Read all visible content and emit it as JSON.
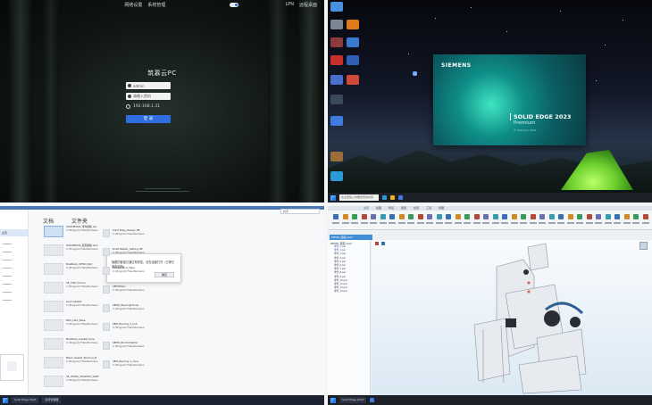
{
  "q1": {
    "top_links": [
      "网络设置",
      "系统管理"
    ],
    "right_labels": [
      "LPN",
      "远程桌面"
    ],
    "title": "筑慕云PC",
    "username": "admin",
    "password_placeholder": "请输入密码",
    "ip": "192.168.1.31",
    "login_label": "登 录"
  },
  "q2": {
    "splash_brand": "SIEMENS",
    "splash_title": "SOLID EDGE 2023",
    "splash_edition": "Premium",
    "splash_version": "© Siemens 2022",
    "taskbar_search": "在这里输入你要搜索的内容",
    "colors": {
      "splash_accent": "#3fe6c2",
      "tent": "#6ccf2c",
      "taskbar": "#1d2026"
    }
  },
  "q3": {
    "header_left": "文档",
    "header_right": "文件夹",
    "search_placeholder": "搜索",
    "sidebar_selected": "主页",
    "files_left": [
      {
        "name": "SOLIDEDGE_零件模板.par",
        "path": "C:/Program Files/Siemens"
      },
      {
        "name": "SOLIDEDGE_装配模板.asm",
        "path": "C:/Program Files/Siemens"
      },
      {
        "name": "BoxBlank_SEMO_Part",
        "path": "C:/Program Files/Siemens"
      },
      {
        "name": "SE_TWD_Frame",
        "path": "C:/Program Files/Siemens"
      },
      {
        "name": "Lead Gasket",
        "path": "C:/Program Files/Siemens"
      },
      {
        "name": "BDS_Lath_Base",
        "path": "C:/Program Files/Siemens"
      },
      {
        "name": "BoxBlank_Gasket_bore",
        "path": "C:/Program Files/Siemens"
      },
      {
        "name": "Blank Gasket_Bordure_B",
        "path": "C:/Program Files/Siemens"
      },
      {
        "name": "SE_WORK_SHADOW_SORT",
        "path": "C:/Program Files/Siemens"
      }
    ],
    "files_right": [
      {
        "name": "Solid Edge_Design.dft",
        "path": "C:/Program Files/Siemens"
      },
      {
        "name": "Draft Master_Setting.dft",
        "path": "C:/Program Files/Siemens"
      },
      {
        "name": "Flange_Mod_Tiger",
        "path": "C:/Program Files/Siemens"
      },
      {
        "name": "SEMOMain",
        "path": "C:/Program Files/Siemens"
      },
      {
        "name": "SEMO_BearingHouse",
        "path": "C:/Program Files/Siemens"
      },
      {
        "name": "SEM_Bearing 2_hub",
        "path": "C:/Program Files/Siemens"
      },
      {
        "name": "SEMO_BlockAdapter",
        "path": "C:/Program Files/Siemens"
      },
      {
        "name": "SEM_Bearing 1_cone",
        "path": "C:/Program Files/Siemens"
      }
    ],
    "dialog_text": "隐藏的链接已通过有效性，请在桌面打开（已拷贝到剪贴板）",
    "dialog_button": "确定",
    "taskbar_apps": [
      "Solid Edge 2023",
      "资源管理器"
    ],
    "colors": {
      "topbar": "#4b76b5",
      "selection": "#dbe7f6"
    }
  },
  "q4": {
    "ribbon_tabs": [
      "主页",
      "绘图",
      "特征",
      "装配",
      "检查",
      "工具",
      "视图"
    ],
    "doc_tab": "DEMO_装配.asm",
    "tree_root": "DEMO_装配.asm",
    "tree_items": [
      "零件_1.par",
      "零件_2.par",
      "零件_3.par",
      "零件_4.par",
      "零件_5.par",
      "零件_6.par",
      "零件_7.par",
      "零件_8.par",
      "零件_9.par",
      "零件_10.par",
      "零件_11.par",
      "零件_12.par",
      "零件_13.par"
    ],
    "taskbar_app": "Solid Edge 2023",
    "colors": {
      "doc_tab": "#3f8fd6",
      "model_belt": "#2e5f8f"
    }
  }
}
